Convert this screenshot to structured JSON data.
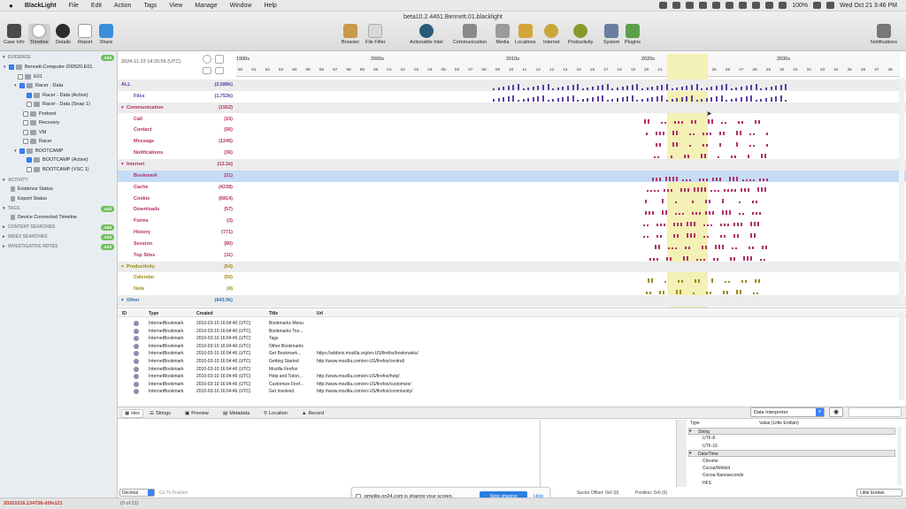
{
  "menubar": {
    "app": "BlackLight",
    "items": [
      "File",
      "Edit",
      "Action",
      "Tags",
      "View",
      "Manage",
      "Window",
      "Help"
    ],
    "status": "100%",
    "clock": "Wed Oct 21  3:46 PM"
  },
  "window": {
    "title": "beta10.2.4461.Bennett.01.blacklight"
  },
  "toolbar": {
    "left": [
      "Case Info",
      "Timeline",
      "Details",
      "Report",
      "Share"
    ],
    "center": [
      "Browser",
      "File Filter",
      "Actionable Intel",
      "Communication",
      "Media",
      "Locations",
      "Internet",
      "Productivity",
      "System",
      "Plugins"
    ],
    "right": "Notifications"
  },
  "colors": {
    "communication": "#b0306a",
    "internet": "#b0306a",
    "productivity": "#9c8a1a",
    "other": "#2d6fb8",
    "files": "#5b3fa3",
    "selected": "#c6dcf6",
    "highlight": "#f4f1b6"
  },
  "sidebar": {
    "evidence_label": "EVIDENCE",
    "add": "Add",
    "tree": [
      {
        "label": "Bennett-Computer-200520.E01",
        "level": 0
      },
      {
        "label": "E01",
        "level": 1
      },
      {
        "label": "Racer - Data",
        "level": 1
      },
      {
        "label": "Racer - Data (Active)",
        "level": 2
      },
      {
        "label": "Racer - Data (Snap 1)",
        "level": 2
      },
      {
        "label": "Preboot",
        "level": 2
      },
      {
        "label": "Recovery",
        "level": 2
      },
      {
        "label": "VM",
        "level": 2
      },
      {
        "label": "Racer",
        "level": 2
      },
      {
        "label": "BOOTCAMP",
        "level": 1
      },
      {
        "label": "BOOTCAMP (Active)",
        "level": 2
      },
      {
        "label": "BOOTCAMP (VSC 1)",
        "level": 2
      }
    ],
    "activity_label": "ACTIVITY",
    "activity": [
      "Evidence Status",
      "Export Status"
    ],
    "tags_label": "TAGS",
    "tags": [
      "Device Connected Timeline"
    ],
    "content_searches": "CONTENT SEARCHES",
    "index_searches": "INDEX SEARCHES",
    "investigative_notes": "INVESTIGATIVE NOTES"
  },
  "timeline": {
    "date": "2024-11-23 14:26:56 (UTC)",
    "decades": [
      "1990s",
      "2000s",
      "2010s",
      "2020s",
      "2030s"
    ],
    "years": [
      "90",
      "91",
      "92",
      "93",
      "94",
      "95",
      "96",
      "97",
      "98",
      "99",
      "00",
      "01",
      "02",
      "03",
      "04",
      "05",
      "06",
      "07",
      "08",
      "09",
      "10",
      "11",
      "12",
      "13",
      "14",
      "15",
      "16",
      "17",
      "18",
      "19",
      "20",
      "21",
      "22",
      "23",
      "24",
      "25",
      "26",
      "27",
      "28",
      "29",
      "30",
      "31",
      "32",
      "33",
      "34",
      "35",
      "36",
      "37",
      "38"
    ],
    "rows": [
      {
        "label": "ALL",
        "count": "(2,588k)",
        "type": "cat"
      },
      {
        "label": "Files",
        "count": "(1,753k)",
        "type": "sub"
      },
      {
        "label": "Communication",
        "count": "(1552)",
        "type": "cat"
      },
      {
        "label": "Call",
        "count": "(15)",
        "type": "sub"
      },
      {
        "label": "Contact",
        "count": "(56)",
        "type": "sub"
      },
      {
        "label": "Message",
        "count": "(1245)",
        "type": "sub"
      },
      {
        "label": "Notifications",
        "count": "(36)",
        "type": "sub"
      },
      {
        "label": "Internet",
        "count": "(12.1k)",
        "type": "cat"
      },
      {
        "label": "Bookmark",
        "count": "(21)",
        "type": "sel"
      },
      {
        "label": "Cache",
        "count": "(4238)",
        "type": "sub"
      },
      {
        "label": "Cookie",
        "count": "(6814)",
        "type": "sub"
      },
      {
        "label": "Downloads",
        "count": "(57)",
        "type": "sub"
      },
      {
        "label": "Forms",
        "count": "(3)",
        "type": "sub"
      },
      {
        "label": "History",
        "count": "(771)",
        "type": "sub"
      },
      {
        "label": "Session",
        "count": "(80)",
        "type": "sub"
      },
      {
        "label": "Top Sites",
        "count": "(11)",
        "type": "sub"
      },
      {
        "label": "Productivity",
        "count": "(54)",
        "type": "cat"
      },
      {
        "label": "Calendar",
        "count": "(50)",
        "type": "sub"
      },
      {
        "label": "Note",
        "count": "(4)",
        "type": "sub"
      },
      {
        "label": "Other",
        "count": "(643.0k)",
        "type": "cat"
      }
    ]
  },
  "list": {
    "headers": [
      "ID",
      "Type",
      "Created",
      "Title",
      "Url"
    ],
    "rows": [
      {
        "type": "InternetBookmark",
        "created": "2010-03-10 16:04:40 (UTC)",
        "title": "Bookmarks Menu",
        "url": ""
      },
      {
        "type": "InternetBookmark",
        "created": "2010-03-10 16:04:40 (UTC)",
        "title": "Bookmarks Too...",
        "url": ""
      },
      {
        "type": "InternetBookmark",
        "created": "2010-03-10 16:04:45 (UTC)",
        "title": "Tags",
        "url": ""
      },
      {
        "type": "InternetBookmark",
        "created": "2010-03-10 16:04:40 (UTC)",
        "title": "Other Bookmarks",
        "url": ""
      },
      {
        "type": "InternetBookmark",
        "created": "2010-03-10 16:04:46 (UTC)",
        "title": "Get Bookmark...",
        "url": "https://addons.mozilla.org/en-US/firefox/bookmarks/"
      },
      {
        "type": "InternetBookmark",
        "created": "2010-03-10 16:04:46 (UTC)",
        "title": "Getting Started",
        "url": "http://www.mozilla.com/en-US/firefox/central/"
      },
      {
        "type": "InternetBookmark",
        "created": "2010-03-10 16:04:46 (UTC)",
        "title": "Mozilla Firefox",
        "url": ""
      },
      {
        "type": "InternetBookmark",
        "created": "2010-03-10 16:04:46 (UTC)",
        "title": "Help and Tutori...",
        "url": "http://www.mozilla.com/en-US/firefox/help/"
      },
      {
        "type": "InternetBookmark",
        "created": "2010-03-10 16:04:46 (UTC)",
        "title": "Customize Firef...",
        "url": "http://www.mozilla.com/en-US/firefox/customize/"
      },
      {
        "type": "InternetBookmark",
        "created": "2010-03-10 16:04:46 (UTC)",
        "title": "Get Involved",
        "url": "http://www.mozilla.com/en-US/firefox/community/"
      }
    ]
  },
  "tabs": [
    "Hex",
    "Strings",
    "Preview",
    "Metadata",
    "Location",
    "Record"
  ],
  "interpreter": {
    "select": "Data Interpreter",
    "col_type": "Type",
    "col_value": "Value (Little Endian)",
    "items": [
      {
        "label": "String",
        "group": true
      },
      {
        "label": "UTF-8",
        "group": false
      },
      {
        "label": "UTF-16",
        "group": false
      },
      {
        "label": "Date/Time",
        "group": true
      },
      {
        "label": "Chrome",
        "group": false
      },
      {
        "label": "Cocoa/Webkit",
        "group": false
      },
      {
        "label": "Cocoa Nanoseconds",
        "group": false
      },
      {
        "label": "HFS",
        "group": false
      }
    ]
  },
  "share": {
    "message": "pmelite.on24.com is sharing your screen.",
    "stop": "Stop sharing",
    "hide": "Hide"
  },
  "statusbar": {
    "left_id": "20201016.134758-d0fe121",
    "count": "(0 of 21)",
    "decimal": "Decimal",
    "goto": "Go To Position",
    "sector": "Sector Offset: 0x0 (0)",
    "position": "Position: 0x0 (0)",
    "endian": "Little Endian"
  }
}
